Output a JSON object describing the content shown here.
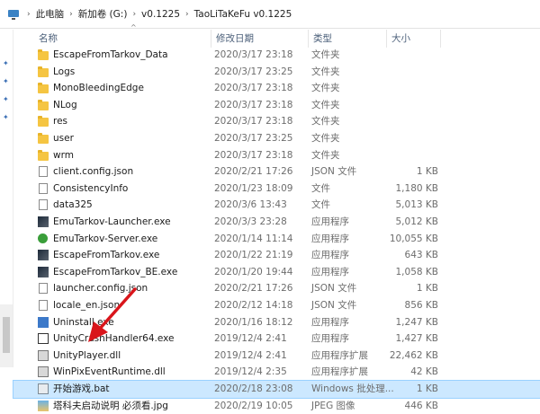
{
  "breadcrumb": {
    "segments": [
      "此电脑",
      "新加卷 (G:)",
      "v0.1225",
      "TaoLiTaKeFu v0.1225"
    ]
  },
  "columns": {
    "name": "名称",
    "date": "修改日期",
    "type": "类型",
    "size": "大小"
  },
  "files": [
    {
      "name": "EscapeFromTarkov_Data",
      "date": "2020/3/17 23:18",
      "type": "文件夹",
      "size": "",
      "icon": "folder-icon"
    },
    {
      "name": "Logs",
      "date": "2020/3/17 23:25",
      "type": "文件夹",
      "size": "",
      "icon": "folder-icon"
    },
    {
      "name": "MonoBleedingEdge",
      "date": "2020/3/17 23:18",
      "type": "文件夹",
      "size": "",
      "icon": "folder-icon"
    },
    {
      "name": "NLog",
      "date": "2020/3/17 23:18",
      "type": "文件夹",
      "size": "",
      "icon": "folder-icon"
    },
    {
      "name": "res",
      "date": "2020/3/17 23:18",
      "type": "文件夹",
      "size": "",
      "icon": "folder-icon"
    },
    {
      "name": "user",
      "date": "2020/3/17 23:25",
      "type": "文件夹",
      "size": "",
      "icon": "folder-icon"
    },
    {
      "name": "wrm",
      "date": "2020/3/17 23:18",
      "type": "文件夹",
      "size": "",
      "icon": "folder-icon"
    },
    {
      "name": "client.config.json",
      "date": "2020/2/21 17:26",
      "type": "JSON 文件",
      "size": "1 KB",
      "icon": "document-icon"
    },
    {
      "name": "ConsistencyInfo",
      "date": "2020/1/23 18:09",
      "type": "文件",
      "size": "1,180 KB",
      "icon": "document-icon"
    },
    {
      "name": "data325",
      "date": "2020/3/6 13:43",
      "type": "文件",
      "size": "5,013 KB",
      "icon": "document-icon"
    },
    {
      "name": "EmuTarkov-Launcher.exe",
      "date": "2020/3/3 23:28",
      "type": "应用程序",
      "size": "5,012 KB",
      "icon": "app-dark-icon"
    },
    {
      "name": "EmuTarkov-Server.exe",
      "date": "2020/1/14 11:14",
      "type": "应用程序",
      "size": "10,055 KB",
      "icon": "app-green-icon"
    },
    {
      "name": "EscapeFromTarkov.exe",
      "date": "2020/1/22 21:19",
      "type": "应用程序",
      "size": "643 KB",
      "icon": "app-dark-icon"
    },
    {
      "name": "EscapeFromTarkov_BE.exe",
      "date": "2020/1/20 19:44",
      "type": "应用程序",
      "size": "1,058 KB",
      "icon": "app-dark-icon"
    },
    {
      "name": "launcher.config.json",
      "date": "2020/2/21 17:26",
      "type": "JSON 文件",
      "size": "1 KB",
      "icon": "document-icon"
    },
    {
      "name": "locale_en.json",
      "date": "2020/2/12 14:18",
      "type": "JSON 文件",
      "size": "856 KB",
      "icon": "document-icon"
    },
    {
      "name": "Uninstall.exe",
      "date": "2020/1/16 18:12",
      "type": "应用程序",
      "size": "1,247 KB",
      "icon": "uninstall-icon"
    },
    {
      "name": "UnityCrashHandler64.exe",
      "date": "2019/12/4 2:41",
      "type": "应用程序",
      "size": "1,427 KB",
      "icon": "unity-icon"
    },
    {
      "name": "UnityPlayer.dll",
      "date": "2019/12/4 2:41",
      "type": "应用程序扩展",
      "size": "22,462 KB",
      "icon": "dll-gear-icon"
    },
    {
      "name": "WinPixEventRuntime.dll",
      "date": "2019/12/4 2:35",
      "type": "应用程序扩展",
      "size": "42 KB",
      "icon": "dll-gear-icon"
    },
    {
      "name": "开始游戏.bat",
      "date": "2020/2/18 23:08",
      "type": "Windows 批处理...",
      "size": "1 KB",
      "icon": "batch-file-icon",
      "selected": true
    },
    {
      "name": "塔科夫启动说明 必须看.jpg",
      "date": "2020/2/19 10:05",
      "type": "JPEG 图像",
      "size": "446 KB",
      "icon": "image-file-icon"
    }
  ],
  "colors": {
    "selection": "#cce8ff",
    "annotation_arrow": "#d9151b",
    "folder": "#f5c542"
  }
}
